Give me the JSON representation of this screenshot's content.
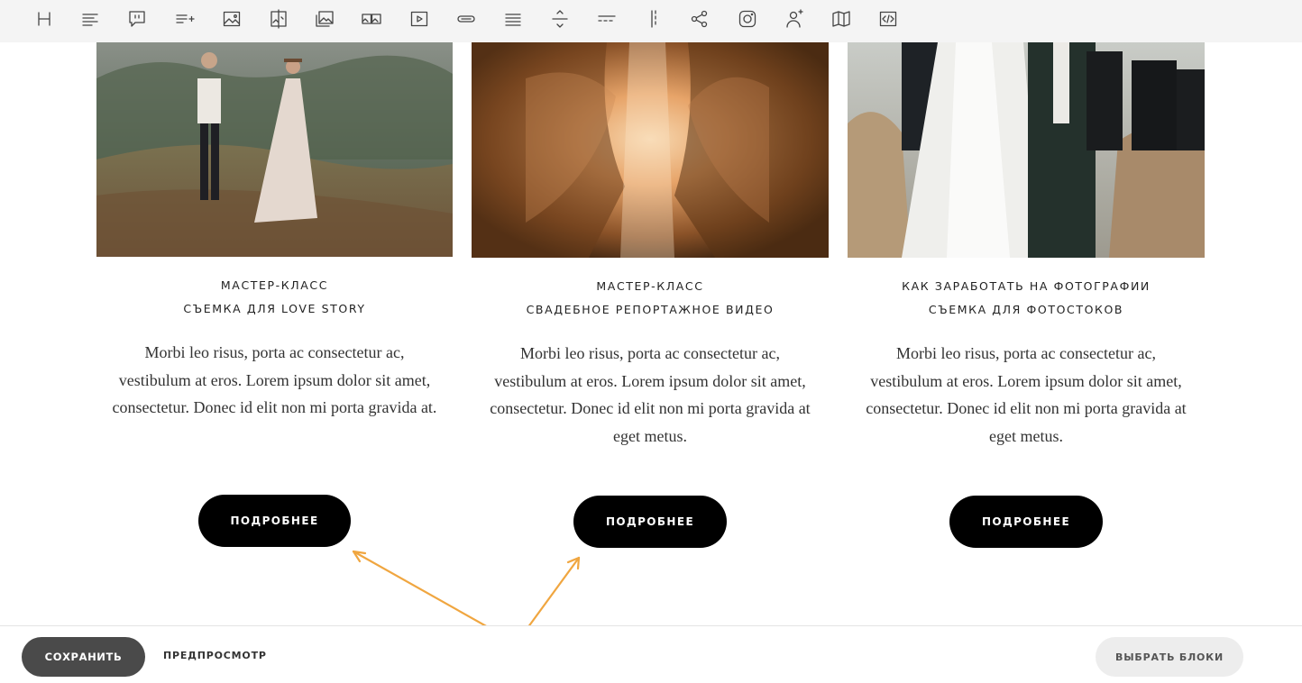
{
  "toolbar": {
    "icons": [
      "heading-icon",
      "text-align-icon",
      "quote-icon",
      "add-list-icon",
      "image-icon",
      "image-compare-icon",
      "gallery-icon",
      "image-pair-icon",
      "video-icon",
      "link-button-icon",
      "lines-block-icon",
      "divider-icon",
      "spacer-dash-icon",
      "vertical-divider-icon",
      "share-icon",
      "instagram-icon",
      "add-user-icon",
      "map-icon",
      "code-icon"
    ]
  },
  "cards": [
    {
      "title_line1": "МАСТЕР-КЛАСС",
      "title_line2": "СЪЕМКА ДЛЯ LOVE STORY",
      "text": "Morbi leo risus, porta ac consectetur ac, vestibulum at eros. Lorem ipsum dolor sit amet, consectetur. Donec id elit non mi porta gravida at.",
      "button": "ПОДРОБНЕЕ"
    },
    {
      "title_line1": "МАСТЕР-КЛАСС",
      "title_line2": "СВАДЕБНОЕ РЕПОРТАЖНОЕ ВИДЕО",
      "text": "Morbi leo risus, porta ac consectetur ac, vestibulum at eros. Lorem ipsum dolor sit amet, consectetur. Donec id elit non mi porta gravida at eget metus.",
      "button": "ПОДРОБНЕЕ"
    },
    {
      "title_line1": "КАК ЗАРАБОТАТЬ НА ФОТОГРАФИИ",
      "title_line2": "СЪЕМКА ДЛЯ ФОТОСТОКОВ",
      "text": "Morbi leo risus, porta ac consectetur ac, vestibulum at eros. Lorem ipsum dolor sit amet, consectetur. Donec id elit non mi porta gravida at eget metus.",
      "button": "ПОДРОБНЕЕ"
    }
  ],
  "bottombar": {
    "save": "СОХРАНИТЬ",
    "preview": "ПРЕДПРОСМОТР",
    "choose_blocks": "ВЫБРАТЬ БЛОКИ"
  },
  "colors": {
    "button_bg": "#000000",
    "save_bg": "#4a4a4a",
    "annotation_arrow": "#f0a640",
    "toolbar_bg": "#f4f4f4"
  }
}
